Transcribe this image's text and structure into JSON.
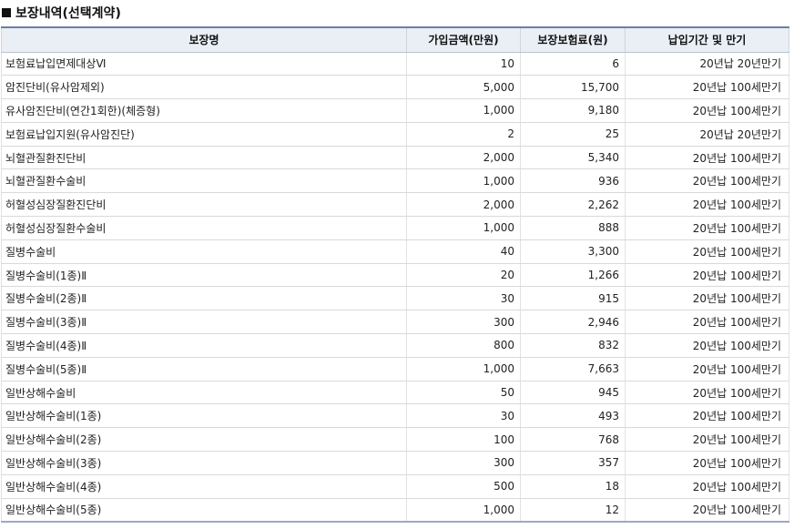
{
  "section": {
    "title": "보장내역(선택계약)"
  },
  "table": {
    "headers": [
      "보장명",
      "가입금액(만원)",
      "보장보험료(원)",
      "납입기간 및 만기"
    ],
    "rows": [
      {
        "name": "보험료납입면제대상Ⅵ",
        "amount": "10",
        "premium": "6",
        "term": "20년납 20년만기"
      },
      {
        "name": "암진단비(유사암제외)",
        "amount": "5,000",
        "premium": "15,700",
        "term": "20년납 100세만기"
      },
      {
        "name": "유사암진단비(연간1회한)(체증형)",
        "amount": "1,000",
        "premium": "9,180",
        "term": "20년납 100세만기"
      },
      {
        "name": "보험료납입지원(유사암진단)",
        "amount": "2",
        "premium": "25",
        "term": "20년납 20년만기"
      },
      {
        "name": "뇌혈관질환진단비",
        "amount": "2,000",
        "premium": "5,340",
        "term": "20년납 100세만기"
      },
      {
        "name": "뇌혈관질환수술비",
        "amount": "1,000",
        "premium": "936",
        "term": "20년납 100세만기"
      },
      {
        "name": "허혈성심장질환진단비",
        "amount": "2,000",
        "premium": "2,262",
        "term": "20년납 100세만기"
      },
      {
        "name": "허혈성심장질환수술비",
        "amount": "1,000",
        "premium": "888",
        "term": "20년납 100세만기"
      },
      {
        "name": "질병수술비",
        "amount": "40",
        "premium": "3,300",
        "term": "20년납 100세만기"
      },
      {
        "name": "질병수술비(1종)Ⅱ",
        "amount": "20",
        "premium": "1,266",
        "term": "20년납 100세만기"
      },
      {
        "name": "질병수술비(2종)Ⅱ",
        "amount": "30",
        "premium": "915",
        "term": "20년납 100세만기"
      },
      {
        "name": "질병수술비(3종)Ⅱ",
        "amount": "300",
        "premium": "2,946",
        "term": "20년납 100세만기"
      },
      {
        "name": "질병수술비(4종)Ⅱ",
        "amount": "800",
        "premium": "832",
        "term": "20년납 100세만기"
      },
      {
        "name": "질병수술비(5종)Ⅱ",
        "amount": "1,000",
        "premium": "7,663",
        "term": "20년납 100세만기"
      },
      {
        "name": "일반상해수술비",
        "amount": "50",
        "premium": "945",
        "term": "20년납 100세만기"
      },
      {
        "name": "일반상해수술비(1종)",
        "amount": "30",
        "premium": "493",
        "term": "20년납 100세만기"
      },
      {
        "name": "일반상해수술비(2종)",
        "amount": "100",
        "premium": "768",
        "term": "20년납 100세만기"
      },
      {
        "name": "일반상해수술비(3종)",
        "amount": "300",
        "premium": "357",
        "term": "20년납 100세만기"
      },
      {
        "name": "일반상해수술비(4종)",
        "amount": "500",
        "premium": "18",
        "term": "20년납 100세만기"
      },
      {
        "name": "일반상해수술비(5종)",
        "amount": "1,000",
        "premium": "12",
        "term": "20년납 100세만기"
      }
    ]
  }
}
